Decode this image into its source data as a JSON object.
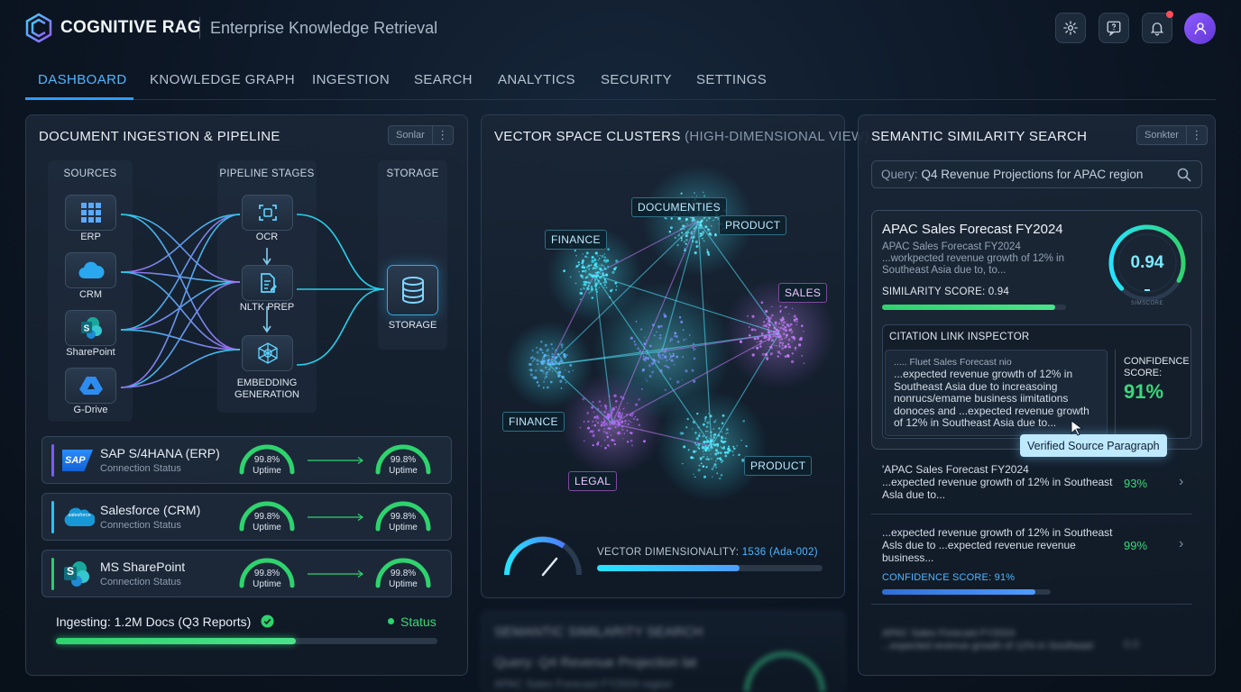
{
  "header": {
    "brand": "COGNITIVE RAG",
    "subtitle": "Enterprise Knowledge Retrieval",
    "icons": [
      "gear-icon",
      "help-chat-icon",
      "bell-icon",
      "user-icon"
    ]
  },
  "tabs": [
    {
      "label": "DASHBOARD",
      "active": true
    },
    {
      "label": "KNOWLEDGE GRAPH"
    },
    {
      "label": "INGESTION"
    },
    {
      "label": "SEARCH"
    },
    {
      "label": "ANALYTICS"
    },
    {
      "label": "SECURITY"
    },
    {
      "label": "SETTINGS"
    }
  ],
  "ingestion": {
    "title": "DOCUMENT INGESTION & PIPELINE",
    "control_label": "Sonlar",
    "columns": {
      "sources": "SOURCES",
      "stages": "PIPELINE STAGES",
      "storage": "STORAGE"
    },
    "sources": [
      "ERP",
      "CRM",
      "SharePoint",
      "G-Drive"
    ],
    "stages": [
      "OCR",
      "NLTK PREP",
      "EMBEDDING GENERATION"
    ],
    "storage_label": "STORAGE",
    "connections": [
      {
        "name": "SAP S/4HANA (ERP)",
        "sub": "Connection Status",
        "logo": "SAP",
        "uptime_in": "99.8%",
        "uptime_out": "99.8%",
        "uptime_label": "Uptime",
        "accent": "#7b5cff"
      },
      {
        "name": "Salesforce (CRM)",
        "sub": "Connection Status",
        "logo": "salesforce",
        "uptime_in": "99.8%",
        "uptime_out": "99.8%",
        "uptime_label": "Uptime",
        "accent": "#27c2ff"
      },
      {
        "name": "MS SharePoint",
        "sub": "Connection Status",
        "logo": "S",
        "uptime_in": "99.8%",
        "uptime_out": "99.8%",
        "uptime_label": "Uptime",
        "accent": "#2ecc71"
      }
    ],
    "uptime_fraction": 0.998,
    "ingesting_text": "Ingesting: 1.2M Docs (Q3 Reports)",
    "status_label": "Status",
    "progress": 0.63
  },
  "clusters": {
    "title": "VECTOR SPACE CLUSTERS",
    "title_muted": "(HIGH-DIMENSIONAL VIEW)",
    "tags": [
      "DOCUMENTIES",
      "PRODUCT",
      "FINANCE",
      "SALES",
      "FINANCE",
      "LEGAL",
      "PRODUCT"
    ],
    "dimensionality_label": "VECTOR DIMENSIONALITY:",
    "dimensionality_value": "1536 (Ada-002)",
    "dimensionality_fill": 0.63
  },
  "ghost": {
    "title": "SEMANTIC SIMILARITY SEARCH",
    "query": "Query: Q4 Revenue Projection lat",
    "snippet": "APAC Sales Forecast FY2024 region"
  },
  "search": {
    "title": "SEMANTIC SIMILARITY SEARCH",
    "control_label": "Sonkter",
    "query_prefix": "Query:",
    "query": "Q4 Revenue Projections for APAC region",
    "top": {
      "title": "APAC Sales Forecast FY2024",
      "line1": "APAC Sales Forecast FY2024",
      "line2": "...workpected revenue growth of 12% in",
      "line3": "Southeast Asia due to, to...",
      "score_label": "SIMILARITY SCORE: 0.94",
      "score": 0.94,
      "score_text": "0.94",
      "gauge_caption": "SIMSCORE"
    },
    "inspector": {
      "title": "CITATION LINK INSPECTOR",
      "lines": [
        "..... Fluet Sales Forecast nio",
        "...expected revenue growth of 12% in",
        "Southeast Asia due to increasoing",
        "nonrucs/emame business iimitations",
        "donoces and ...expected revenue growth",
        "of 12% in Southeast Asia due to..."
      ],
      "confidence_label_1": "CONFIDENCE",
      "confidence_label_2": "SCORE:",
      "confidence_value": "91%",
      "tooltip": "Verified Source Paragraph"
    },
    "results": [
      {
        "lines": [
          "'APAC Sales Forecast FY2024",
          "...expected revenue growth of 12% in Southeast",
          "Asla due to..."
        ],
        "pct": "93%"
      },
      {
        "lines": [
          "...expected revenue growth of 12% in Southeast",
          "Asls due to ...expected revenue revenue",
          "business..."
        ],
        "pct": "99%"
      }
    ],
    "confidence_row": {
      "label": "CONFIDENCE SCORE:",
      "value": "91%",
      "fill": 0.91
    },
    "ghost_result": {
      "lines": [
        "APAC Sales Forecast FY2024",
        "...expected revenue growth of 12% in Southeast"
      ],
      "pct": "0.0"
    }
  },
  "colors": {
    "accent": "#2f9bff",
    "green": "#39d97a",
    "cyan": "#27e3ff",
    "purple": "#b06bff"
  }
}
